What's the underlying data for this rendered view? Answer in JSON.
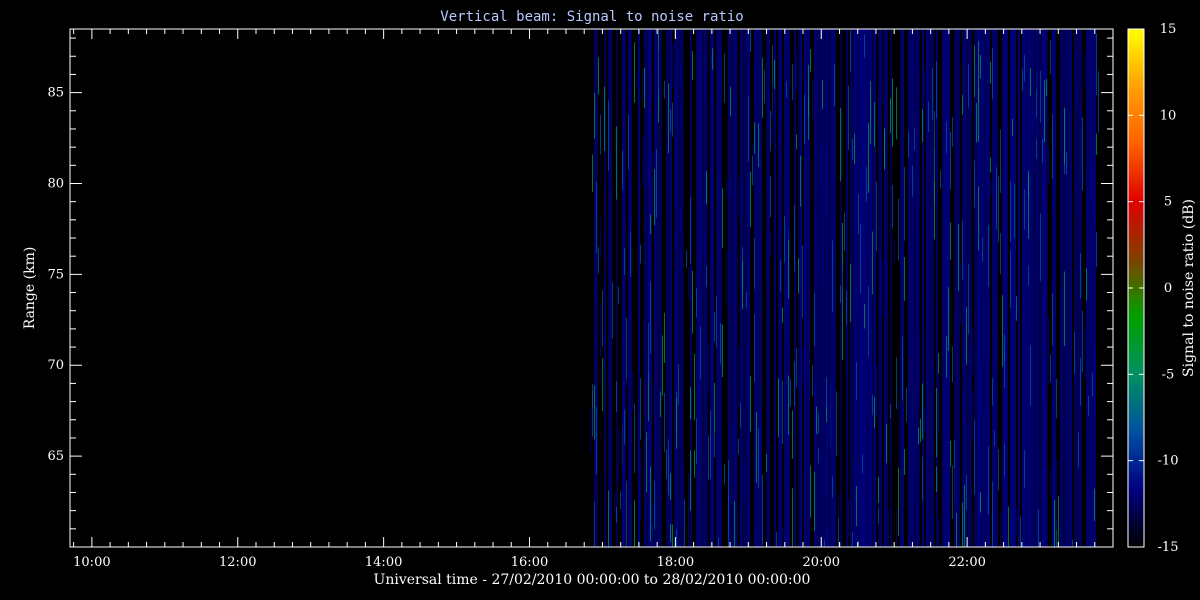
{
  "chart_data": {
    "type": "heatmap",
    "title": "Vertical beam: Signal to noise ratio",
    "xlabel": "Universal time - 27/02/2010 00:00:00 to 28/02/2010 00:00:00",
    "ylabel": "Range (km)",
    "x_range_hours": [
      9.7,
      24.0
    ],
    "x_ticks": [
      "10:00",
      "12:00",
      "14:00",
      "16:00",
      "18:00",
      "20:00",
      "22:00"
    ],
    "x_tick_hours": [
      10,
      12,
      14,
      16,
      18,
      20,
      22
    ],
    "ylim": [
      60,
      88.5
    ],
    "y_ticks": [
      65,
      70,
      75,
      80,
      85
    ],
    "data_start_hour": 16.83,
    "data_end_hour": 23.8,
    "typical_value_db": -13,
    "colorbar": {
      "label": "Signal to noise ratio (dB)",
      "range": [
        -15,
        15
      ],
      "ticks": [
        -15,
        -10,
        -5,
        0,
        5,
        10,
        15
      ],
      "colors": [
        "#000000",
        "#000080",
        "#0050a0",
        "#009060",
        "#00a000",
        "#804000",
        "#e00000",
        "#ff6000",
        "#ffa000",
        "#ffff00"
      ]
    }
  }
}
